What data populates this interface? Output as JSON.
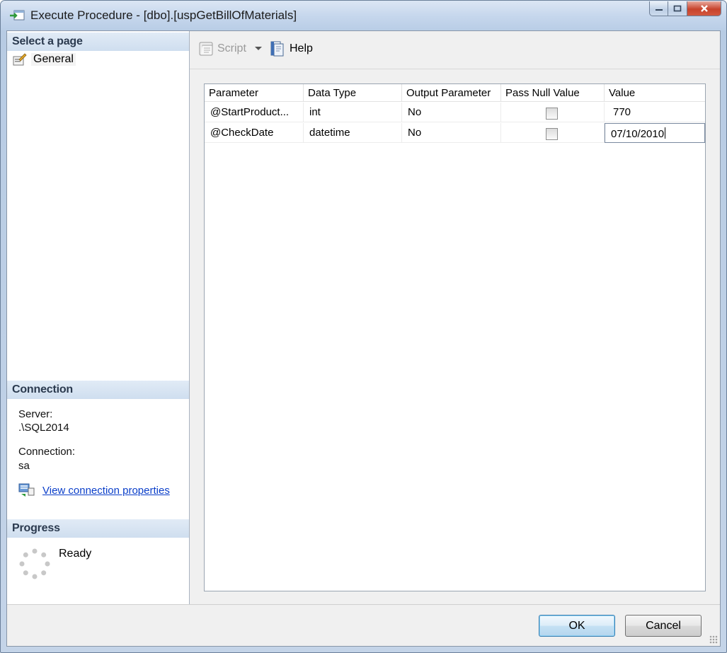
{
  "window": {
    "title": "Execute Procedure - [dbo].[uspGetBillOfMaterials]"
  },
  "left": {
    "select_page_header": "Select a page",
    "pages": [
      {
        "label": "General",
        "icon": "properties-page-icon"
      }
    ],
    "connection_header": "Connection",
    "server_label": "Server:",
    "server_value": ".\\SQL2014",
    "connection_label": "Connection:",
    "connection_value": "sa",
    "view_props_link": "View connection properties",
    "progress_header": "Progress",
    "progress_status": "Ready"
  },
  "toolbar": {
    "script_label": "Script",
    "help_label": "Help"
  },
  "grid": {
    "columns": [
      "Parameter",
      "Data Type",
      "Output Parameter",
      "Pass Null Value",
      "Value"
    ],
    "rows": [
      {
        "parameter": "@StartProduct...",
        "data_type": "int",
        "output": "No",
        "pass_null": false,
        "value": "770"
      },
      {
        "parameter": "@CheckDate",
        "data_type": "datetime",
        "output": "No",
        "pass_null": false,
        "value": "07/10/2010"
      }
    ]
  },
  "buttons": {
    "ok": "OK",
    "cancel": "Cancel"
  },
  "colors": {
    "link": "#0a3ec9",
    "header_text": "#2b3a4f",
    "close_button": "#c7432c"
  }
}
